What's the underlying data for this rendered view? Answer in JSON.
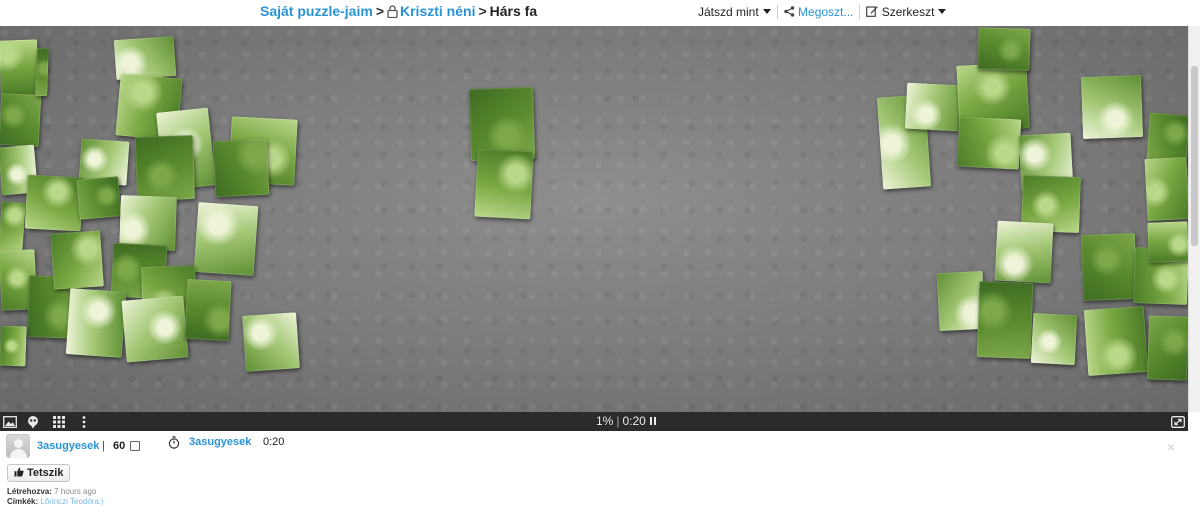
{
  "breadcrumb": {
    "root": "Saját puzzle-jaim",
    "separator": ">",
    "folder": "Kriszti néni",
    "current": "Hárs fa"
  },
  "actions": {
    "play_as": "Játszd mint",
    "share": "Megoszt...",
    "edit": "Szerkeszt"
  },
  "toolbar": {
    "progress": "1%",
    "divider": "|",
    "timer": "0:20"
  },
  "icons": {
    "image": "image-icon",
    "ghost": "ghost-icon",
    "grid": "grid-icon",
    "more": "more-icon",
    "fullscreen": "fullscreen-icon",
    "lock": "lock-icon",
    "share": "share-icon",
    "edit": "edit-icon",
    "timer": "stopwatch-icon",
    "like": "thumbs-up-icon"
  },
  "footer": {
    "author": "3asugyesek",
    "pipe": "|",
    "piece_count": "60",
    "solver": "3asugyesek",
    "solve_time": "0:20",
    "close": "×",
    "like_label": "Tetszik",
    "created_label": "Létrehozva:",
    "created_value": "7 hours ago",
    "tags_label": "Címkék:",
    "tags_value": "Lőrinczi Teodóra:)"
  },
  "colors": {
    "link": "#2a93d5",
    "board": "#7a7a7a",
    "toolbar": "#2b2b2b"
  }
}
